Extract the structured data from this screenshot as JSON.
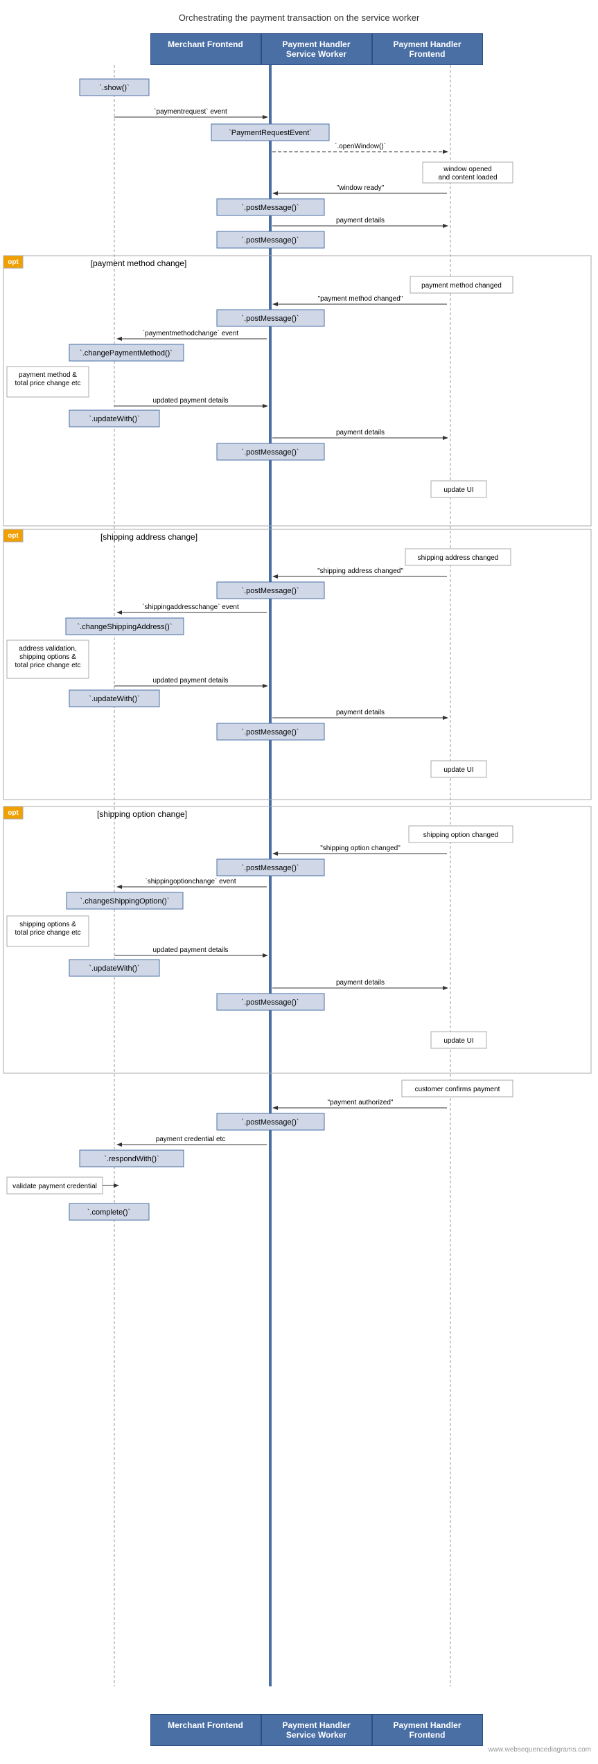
{
  "title": "Orchestrating the payment transaction on the service worker",
  "headers": {
    "merchant": "Merchant Frontend",
    "handler": "Payment Handler Service Worker",
    "frontend": "Payment Handler Frontend"
  },
  "watermark": "www.websequencediagrams.com"
}
